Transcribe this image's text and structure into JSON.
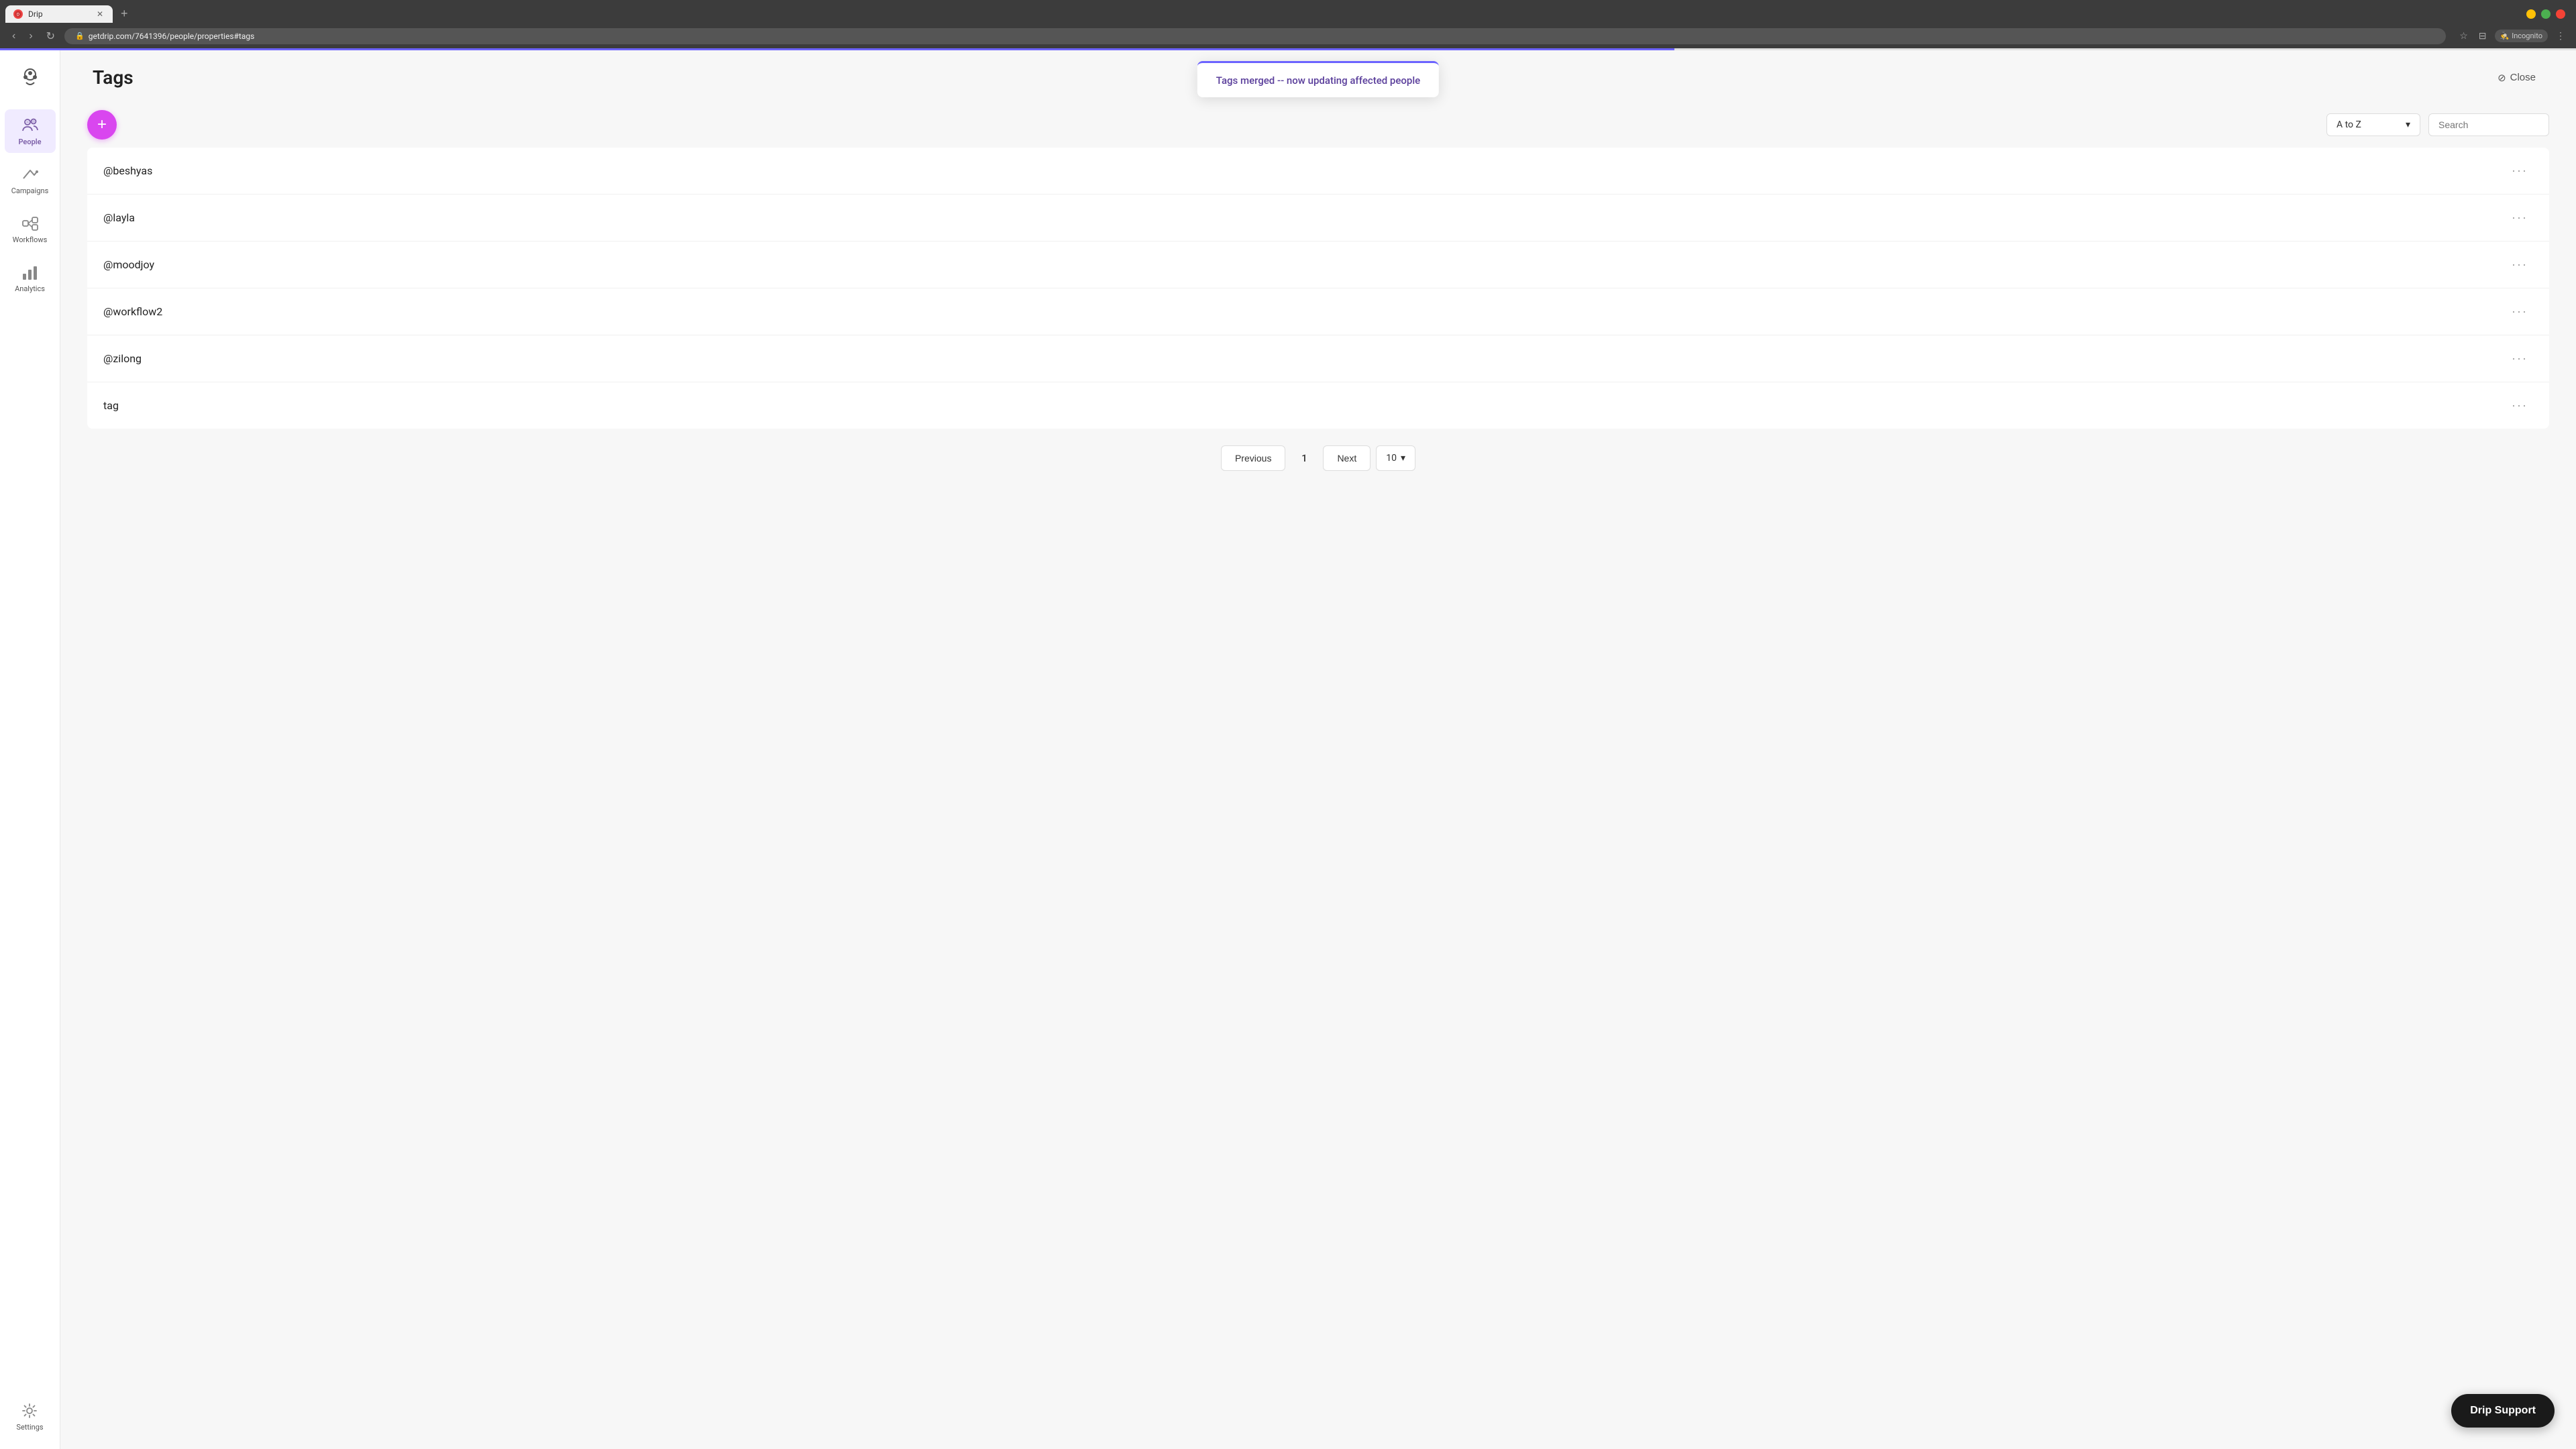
{
  "browser": {
    "tab_title": "Drip",
    "tab_favicon": "D",
    "url": "getdrip.com/7641396/people/properties#tags",
    "incognito_label": "Incognito"
  },
  "toast": {
    "message": "Tags merged -- now updating affected people"
  },
  "sidebar": {
    "logo_alt": "Drip logo",
    "items": [
      {
        "id": "people",
        "label": "People",
        "active": true
      },
      {
        "id": "campaigns",
        "label": "Campaigns",
        "active": false
      },
      {
        "id": "workflows",
        "label": "Workflows",
        "active": false
      },
      {
        "id": "analytics",
        "label": "Analytics",
        "active": false
      }
    ],
    "settings_label": "Settings"
  },
  "page": {
    "title": "Tags",
    "close_label": "Close"
  },
  "toolbar": {
    "add_label": "+",
    "sort_label": "A to Z",
    "sort_arrow": "▾",
    "search_placeholder": "Search"
  },
  "tags": [
    {
      "name": "@beshyas"
    },
    {
      "name": "@layla"
    },
    {
      "name": "@moodjoy"
    },
    {
      "name": "@workflow2"
    },
    {
      "name": "@zilong"
    },
    {
      "name": "tag"
    }
  ],
  "pagination": {
    "previous_label": "Previous",
    "next_label": "Next",
    "current_page": "1",
    "per_page": "10",
    "per_page_arrow": "▾"
  },
  "drip_support": {
    "label": "Drip Support"
  }
}
